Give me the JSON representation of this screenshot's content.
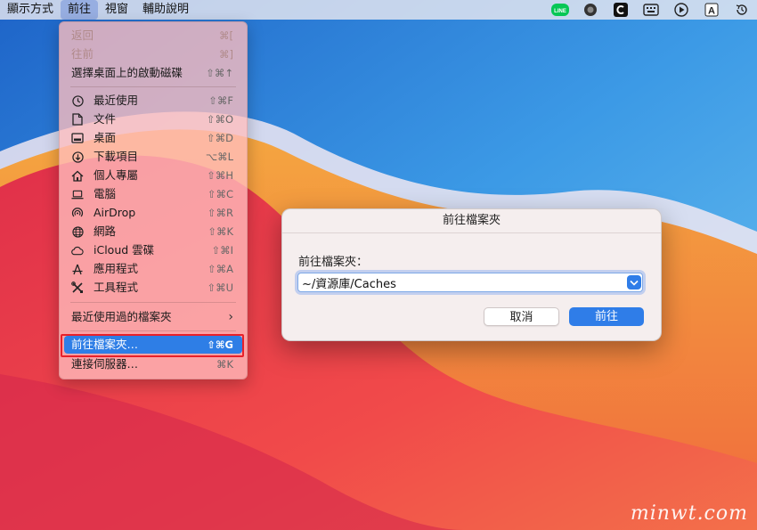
{
  "menubar": {
    "items": [
      {
        "label": "顯示方式",
        "active": false
      },
      {
        "label": "前往",
        "active": true
      },
      {
        "label": "視窗",
        "active": false
      },
      {
        "label": "輔助說明",
        "active": false
      }
    ],
    "tray": [
      {
        "icon": "line-app-icon",
        "text": "LINE",
        "color": "#06c755"
      },
      {
        "icon": "record-icon"
      },
      {
        "icon": "clipboard-app-icon"
      },
      {
        "icon": "keyboard-icon"
      },
      {
        "icon": "play-icon"
      },
      {
        "icon": "input-method-icon",
        "text": "A"
      },
      {
        "icon": "time-machine-icon"
      }
    ]
  },
  "menu": {
    "items": [
      {
        "label": "返回",
        "shortcut": "⌘[",
        "disabled": true
      },
      {
        "label": "往前",
        "shortcut": "⌘]",
        "disabled": true
      },
      {
        "label": "選擇桌面上的啟動磁碟",
        "shortcut": "⇧⌘↑"
      },
      {
        "label": "最近使用",
        "shortcut": "⇧⌘F",
        "icon": "clock-icon"
      },
      {
        "label": "文件",
        "shortcut": "⇧⌘O",
        "icon": "document-icon"
      },
      {
        "label": "桌面",
        "shortcut": "⇧⌘D",
        "icon": "desktop-icon"
      },
      {
        "label": "下載項目",
        "shortcut": "⌥⌘L",
        "icon": "download-icon"
      },
      {
        "label": "個人專屬",
        "shortcut": "⇧⌘H",
        "icon": "home-icon"
      },
      {
        "label": "電腦",
        "shortcut": "⇧⌘C",
        "icon": "laptop-icon"
      },
      {
        "label": "AirDrop",
        "shortcut": "⇧⌘R",
        "icon": "airdrop-icon"
      },
      {
        "label": "網路",
        "shortcut": "⇧⌘K",
        "icon": "globe-icon"
      },
      {
        "label": "iCloud 雲碟",
        "shortcut": "⇧⌘I",
        "icon": "cloud-icon"
      },
      {
        "label": "應用程式",
        "shortcut": "⇧⌘A",
        "icon": "applications-icon"
      },
      {
        "label": "工具程式",
        "shortcut": "⇧⌘U",
        "icon": "utilities-icon"
      },
      {
        "label": "最近使用過的檔案夾",
        "shortcut": "›"
      },
      {
        "label": "前往檔案夾…",
        "shortcut": "⇧⌘G",
        "highlighted": true
      },
      {
        "label": "連接伺服器…",
        "shortcut": "⌘K"
      }
    ]
  },
  "dialog": {
    "title": "前往檔案夾",
    "label": "前往檔案夾：",
    "path_value": "~/資源庫/Caches",
    "cancel_label": "取消",
    "go_label": "前往",
    "accent": "#2f7de8"
  },
  "watermark": "minwt.com",
  "colors": {
    "highlight_box": "#e8202a",
    "menu_highlight": "#2e7ee6"
  }
}
